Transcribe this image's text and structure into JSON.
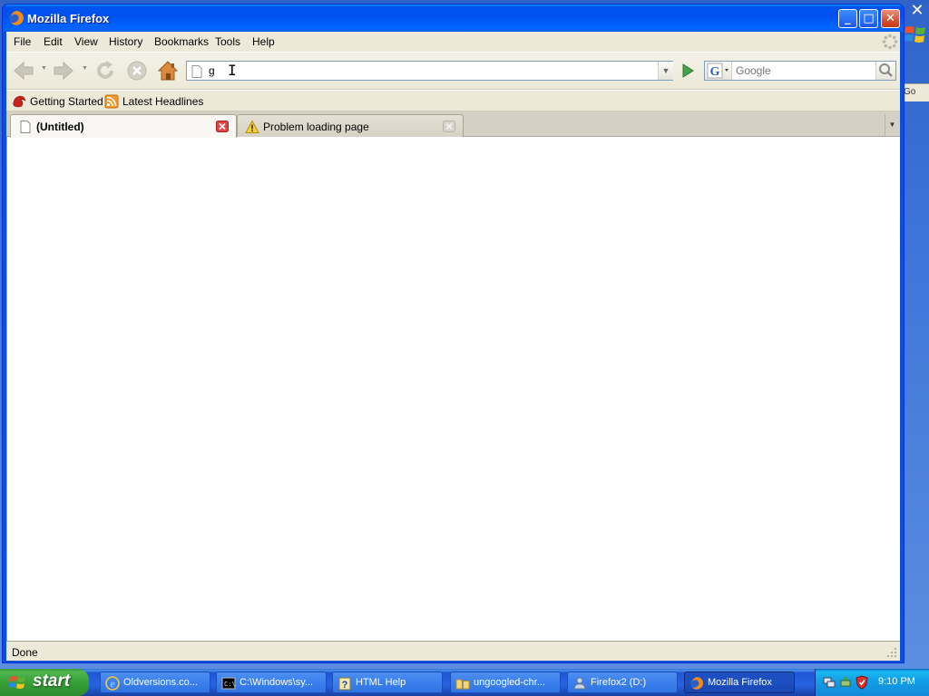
{
  "window": {
    "title": "Mozilla Firefox",
    "minimize_label": "_",
    "maximize_label": "□",
    "close_label": "✕"
  },
  "menu": {
    "items": [
      "File",
      "Edit",
      "View",
      "History",
      "Bookmarks",
      "Tools",
      "Help"
    ]
  },
  "navbar": {
    "url_value": "g",
    "search_placeholder": "Google",
    "search_engine": "G"
  },
  "bookmarks": {
    "items": [
      {
        "label": "Getting Started",
        "icon": "firefox-star-icon"
      },
      {
        "label": "Latest Headlines",
        "icon": "rss-feed-icon"
      }
    ]
  },
  "tabs": [
    {
      "label": "(Untitled)",
      "selected": true,
      "icon": "blank-page-icon"
    },
    {
      "label": "Problem loading page",
      "selected": false,
      "icon": "warning-icon"
    }
  ],
  "status": {
    "text": "Done"
  },
  "desktop": {
    "behind_window_text": "Go",
    "close_label": "✕"
  },
  "taskbar": {
    "start_label": "start",
    "tasks": [
      {
        "label": "Oldversions.co...",
        "icon": "ie-icon",
        "active": false
      },
      {
        "label": "C:\\Windows\\sy...",
        "icon": "cmd-icon",
        "active": false
      },
      {
        "label": "HTML Help",
        "icon": "help-icon",
        "active": false
      },
      {
        "label": "ungoogled-chr...",
        "icon": "folder-zip-icon",
        "active": false
      },
      {
        "label": "Firefox2 (D:)",
        "icon": "drive-icon",
        "active": false
      },
      {
        "label": "Mozilla Firefox",
        "icon": "firefox-icon",
        "active": true
      }
    ],
    "clock": "9:10 PM"
  },
  "colors": {
    "xp_blue": "#0a51d8",
    "xp_green": "#37a037",
    "chrome_beige": "#ece9d8",
    "tab_close_red": "#e04343"
  }
}
